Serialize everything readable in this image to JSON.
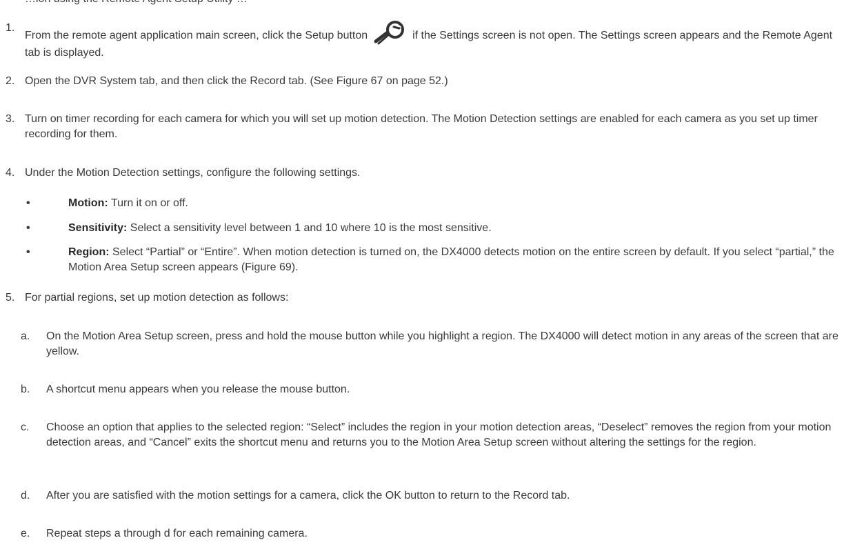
{
  "intro": "…ion using the Remote Agent Setup Utility …",
  "steps": {
    "s1": {
      "num": "1.",
      "text_before": "From the remote agent application main screen, click the Setup button",
      "icon": "wrench-setup-icon",
      "text_after": "if the Settings screen is not open. The Settings screen appears and the Remote Agent tab is displayed."
    },
    "s2": {
      "num": "2.",
      "text": "Open the DVR System tab, and then click the Record tab. (See Figure 67 on page 52.)"
    },
    "s3": {
      "num": "3.",
      "text": "Turn on timer recording for each camera for which you will set up motion detection. The Motion Detection settings are enabled for each camera as you set up timer recording for them."
    },
    "s4": {
      "num": "4.",
      "text": "Under the Motion Detection settings, configure the following settings.",
      "bullets": {
        "b1": {
          "dot": "•",
          "label": "Motion:",
          "text": " Turn it on or off."
        },
        "b2": {
          "dot": "•",
          "label": "Sensitivity:",
          "text": " Select a sensitivity level between 1 and 10 where 10 is the most sensitive."
        },
        "b3": {
          "dot": "•",
          "label": "Region:",
          "text": " Select “Partial” or “Entire”. When motion detection is turned on, the DX4000 detects motion on the entire screen by default. If you select “partial,” the Motion Area Setup screen appears (Figure 69)."
        }
      }
    },
    "s5": {
      "num": "5.",
      "text": "For partial regions, set up motion detection as follows:",
      "subs": {
        "a": {
          "letter": "a.",
          "text": "On the Motion Area Setup screen, press and hold the mouse button while you highlight a region. The DX4000 will detect motion in any areas of the screen that are yellow."
        },
        "b": {
          "letter": "b.",
          "text": "A shortcut menu appears when you release the mouse button."
        },
        "c": {
          "letter": "c.",
          "text": "Choose an option that applies to the selected region: “Select” includes the region in your motion detection areas, “Deselect” removes the region from your motion detection areas, and “Cancel” exits the shortcut menu and returns you to the Motion Area Setup screen without altering the settings for the region."
        },
        "d": {
          "letter": "d.",
          "text": "After you are satisfied with the motion settings for a camera, click the OK button to return to the Record tab."
        },
        "e": {
          "letter": "e.",
          "text": "Repeat steps a through d for each remaining camera."
        }
      }
    }
  }
}
